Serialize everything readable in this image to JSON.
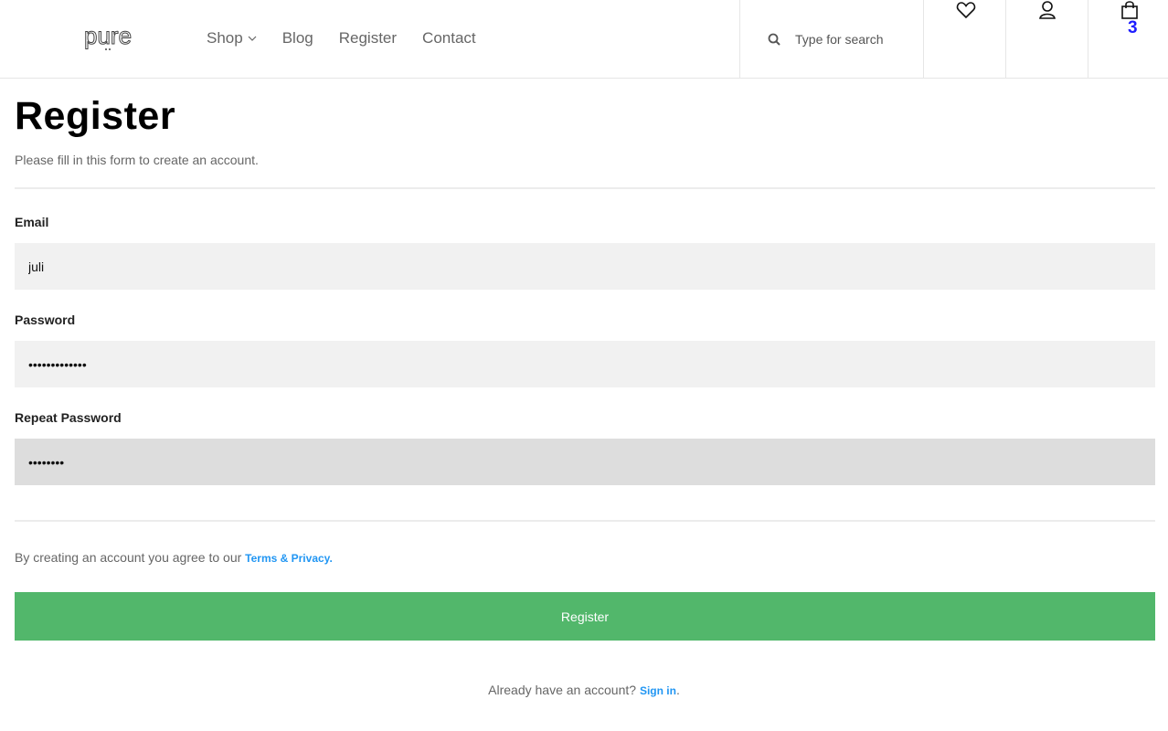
{
  "header": {
    "logo_text": "pure",
    "nav": [
      {
        "label": "Shop"
      },
      {
        "label": "Blog"
      },
      {
        "label": "Register"
      },
      {
        "label": "Contact"
      }
    ],
    "search_placeholder": "Type for search",
    "cart_count": "3"
  },
  "main": {
    "title": "Register",
    "subtitle": "Please fill in this form to create an account.",
    "fields": [
      {
        "label": "Email",
        "value": "juli",
        "type": "text"
      },
      {
        "label": "Password",
        "value": "•••••••••••••",
        "type": "password"
      },
      {
        "label": "Repeat Password",
        "value": "••••••••",
        "type": "password"
      }
    ],
    "terms_text": "By creating an account you agree to our ",
    "terms_link": "Terms & Privacy",
    "terms_period": ".",
    "register_button": "Register",
    "signin_text": "Already have an account? ",
    "signin_link": "Sign in",
    "signin_period": "."
  },
  "colors": {
    "accent_green": "#52b76b",
    "link_blue": "#2196f3",
    "cart_badge": "#1d1dff"
  }
}
